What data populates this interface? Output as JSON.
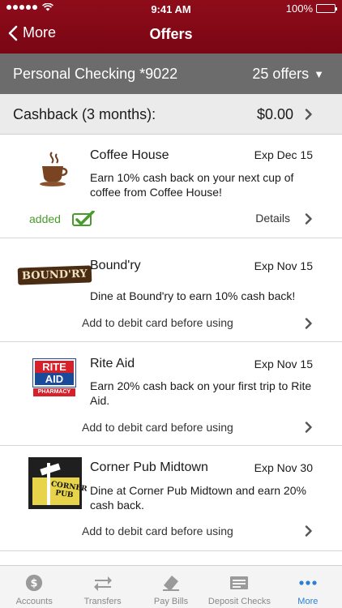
{
  "status_bar": {
    "time": "9:41 AM",
    "battery": "100%"
  },
  "nav": {
    "back_label": "More",
    "title": "Offers"
  },
  "account": {
    "name": "Personal Checking *9022",
    "offers_count": "25 offers"
  },
  "cashback": {
    "label": "Cashback (3 months):",
    "amount": "$0.00"
  },
  "offers": [
    {
      "name": "Coffee House",
      "exp": "Exp Dec 15",
      "desc": "Earn 10% cash back on your next cup of coffee from Coffee House!",
      "status": "added",
      "details_label": "Details",
      "logo": "coffee-cup-icon"
    },
    {
      "name": "Bound'ry",
      "exp": "Exp Nov 15",
      "desc": "Dine at Bound'ry to earn 10% cash back!",
      "action": "Add to debit card before using",
      "logo_text": "BOUND'RY"
    },
    {
      "name": "Rite Aid",
      "exp": "Exp Nov 15",
      "desc": "Earn 20% cash back on your first trip to Rite Aid.",
      "action": "Add to debit card before using",
      "logo_text": {
        "top": "RITE",
        "bottom": "AID",
        "sub": "PHARMACY"
      }
    },
    {
      "name": "Corner Pub Midtown",
      "exp": "Exp Nov 30",
      "desc": "Dine at Corner Pub Midtown and earn 20% cash back.",
      "action": "Add to debit card before using",
      "logo_text": "CORNER PUB"
    }
  ],
  "tabs": [
    {
      "label": "Accounts",
      "icon": "dollar-icon"
    },
    {
      "label": "Transfers",
      "icon": "transfer-arrows-icon"
    },
    {
      "label": "Pay Bills",
      "icon": "pay-bills-icon"
    },
    {
      "label": "Deposit Checks",
      "icon": "check-icon"
    },
    {
      "label": "More",
      "icon": "more-dots-icon",
      "active": true
    }
  ],
  "colors": {
    "header": "#7a0614",
    "account_bar": "#6c6c6c",
    "added": "#4a9b2d",
    "active_tab": "#2b7fd6"
  }
}
